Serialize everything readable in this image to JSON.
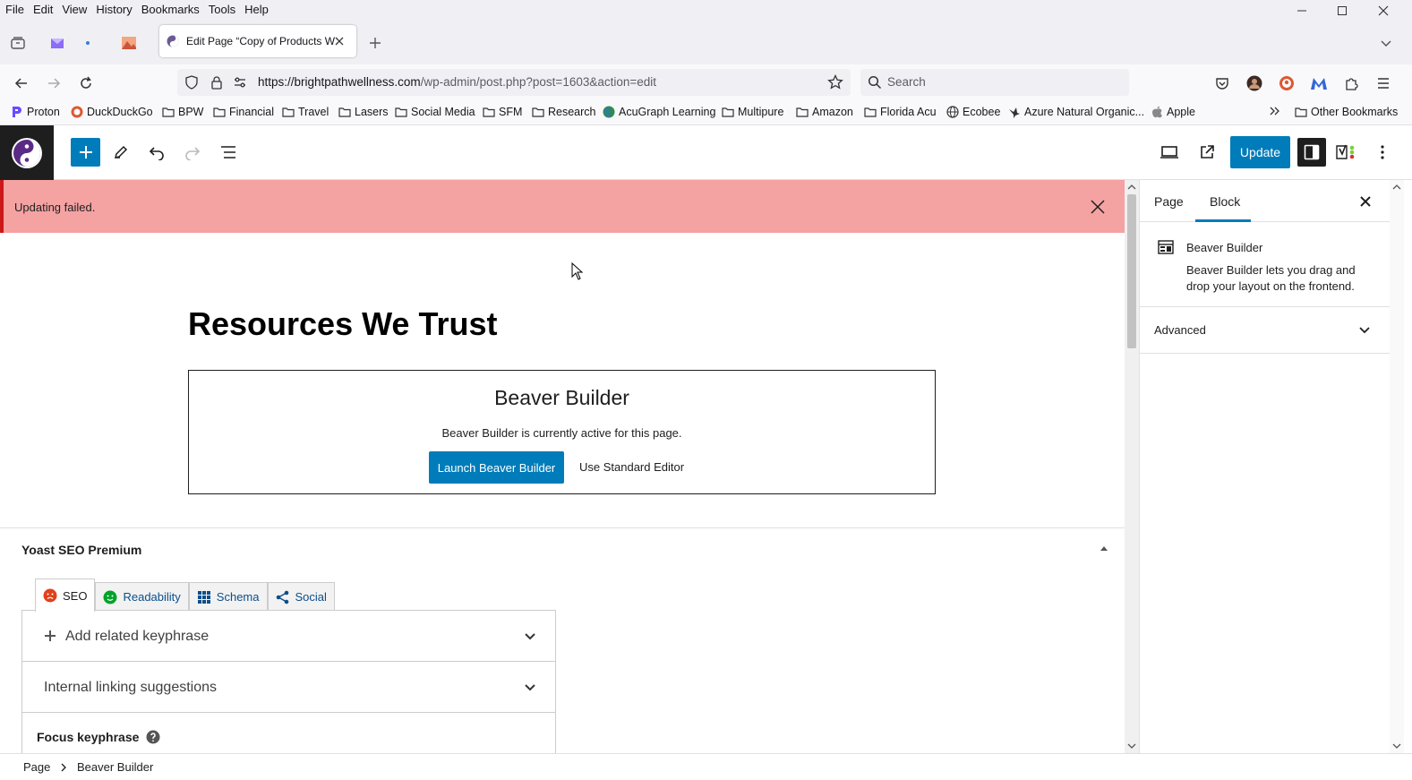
{
  "browser": {
    "menu": [
      "File",
      "Edit",
      "View",
      "History",
      "Bookmarks",
      "Tools",
      "Help"
    ],
    "tab_title": "Edit Page “Copy of Products W",
    "url_domain": "https://brightpathwellness.com",
    "url_path": "/wp-admin/post.php?post=1603&action=edit",
    "search_placeholder": "Search",
    "bookmarks": [
      "Proton",
      "DuckDuckGo",
      "BPW",
      "Financial",
      "Travel",
      "Lasers",
      "Social Media",
      "SFM",
      "Research",
      "AcuGraph Learning",
      "Multipure",
      "Amazon",
      "Florida Acu",
      "Ecobee",
      "Azure Natural Organic...",
      "Apple"
    ],
    "other_bookmarks": "Other Bookmarks"
  },
  "editor": {
    "update_label": "Update",
    "notice": "Updating failed.",
    "page_title": "Resources We Trust",
    "beaver": {
      "heading": "Beaver Builder",
      "text": "Beaver Builder is currently active for this page.",
      "launch_label": "Launch Beaver Builder",
      "standard_label": "Use Standard Editor"
    },
    "yoast": {
      "title": "Yoast SEO Premium",
      "tabs": [
        "SEO",
        "Readability",
        "Schema",
        "Social"
      ],
      "related_keyphrase": "Add related keyphrase",
      "linking": "Internal linking suggestions",
      "focus_keyphrase": "Focus keyphrase"
    }
  },
  "sidebar": {
    "tab_page": "Page",
    "tab_block": "Block",
    "block_name": "Beaver Builder",
    "block_desc": "Beaver Builder lets you drag and drop your layout on the frontend.",
    "advanced": "Advanced"
  },
  "breadcrumb": [
    "Page",
    "Beaver Builder"
  ],
  "colors": {
    "wp_blue": "#007cba",
    "notice_bg": "#f4a2a2",
    "yoast_seo_status": "#e2401c",
    "yoast_readability_status": "#00a32a"
  }
}
